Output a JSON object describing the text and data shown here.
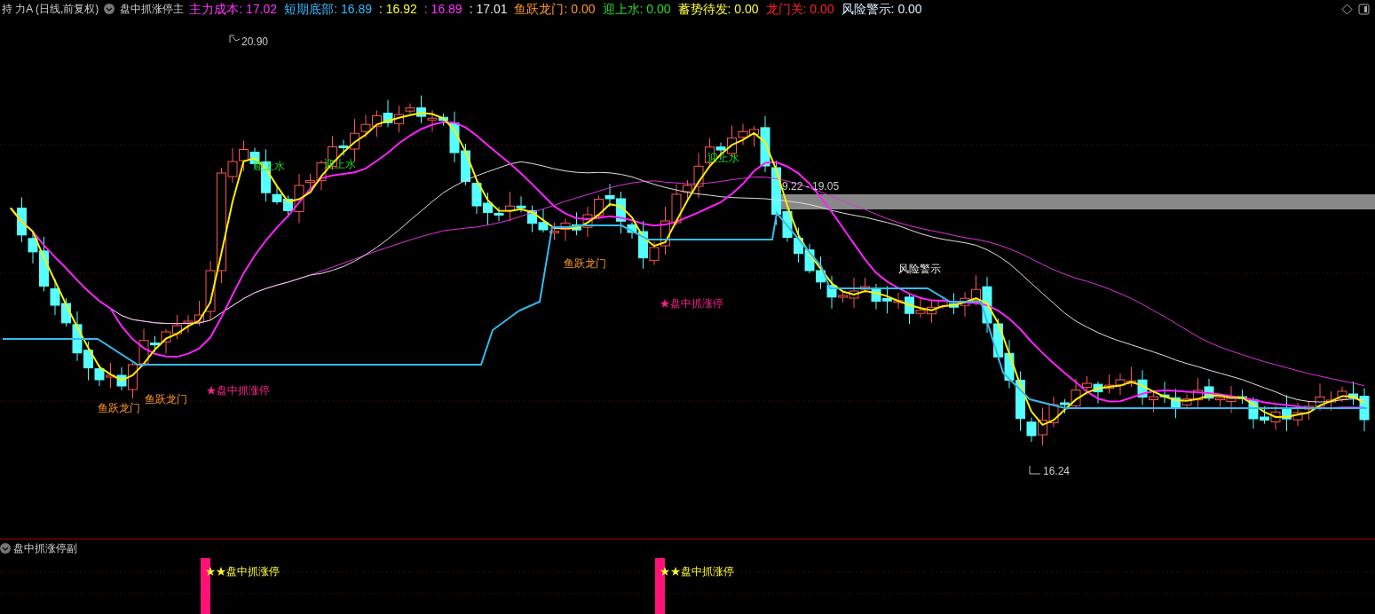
{
  "header": {
    "stock": "持 力A (日线,前复权)",
    "indicator_name": "盘中抓涨停主",
    "values": [
      {
        "text": "主力成本: 17.02",
        "color": "#ff33ff"
      },
      {
        "text": "短期底部: 16.89",
        "color": "#33bbff"
      },
      {
        "text": ": 16.92",
        "color": "#ffff33"
      },
      {
        "text": ": 16.89",
        "color": "#ff33ff"
      },
      {
        "text": ": 17.01",
        "color": "#e8e8e8"
      },
      {
        "text": "鱼跃龙门: 0.00",
        "color": "#ff9922"
      },
      {
        "text": "迎上水: 0.00",
        "color": "#22dd22"
      },
      {
        "text": "蓄势待发: 0.00",
        "color": "#ffff33"
      },
      {
        "text": "龙门关: 0.00",
        "color": "#ff2222"
      },
      {
        "text": "风险警示: 0.00",
        "color": "#ddeeff"
      }
    ]
  },
  "main_chart": {
    "high_label": "20.90",
    "low_label": "16.24",
    "band_label": "9.22 - 19.05",
    "signals": [
      {
        "text": "迎上水",
        "kind": "water"
      },
      {
        "text": "迎上水",
        "kind": "water"
      },
      {
        "text": "迎上水",
        "kind": "water"
      },
      {
        "text": "鱼跃龙门",
        "kind": "dragon"
      },
      {
        "text": "鱼跃龙门",
        "kind": "dragon"
      },
      {
        "text": "鱼跃龙门",
        "kind": "dragon"
      },
      {
        "text": "★盘中抓涨停",
        "kind": "limit"
      },
      {
        "text": "★盘中抓涨停",
        "kind": "limit"
      },
      {
        "text": "风险警示",
        "kind": "risk"
      }
    ]
  },
  "sub_panel": {
    "title": "盘中抓涨停副",
    "signals": [
      {
        "text": "★★盘中抓涨停"
      },
      {
        "text": "★★盘中抓涨停"
      }
    ]
  }
}
